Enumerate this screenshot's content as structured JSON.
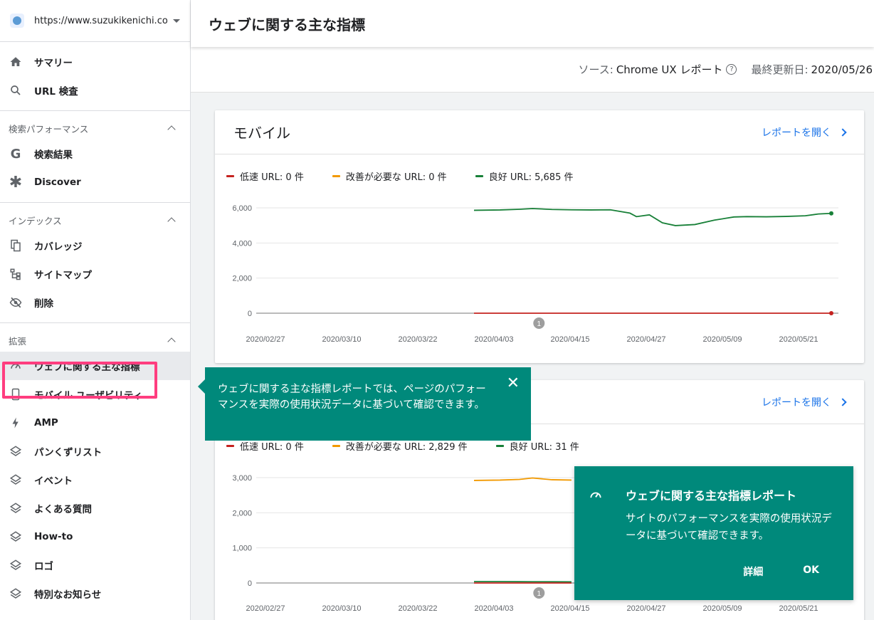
{
  "property": {
    "url": "https://www.suzukikenichi.co..."
  },
  "sidebar": {
    "top": [
      {
        "label": "サマリー",
        "icon": "home-icon"
      },
      {
        "label": "URL 検査",
        "icon": "search-icon"
      }
    ],
    "groups": [
      {
        "title": "検索パフォーマンス",
        "items": [
          {
            "label": "検索結果",
            "icon": "google-icon"
          },
          {
            "label": "Discover",
            "icon": "asterisk-icon"
          }
        ]
      },
      {
        "title": "インデックス",
        "items": [
          {
            "label": "カバレッジ",
            "icon": "copy-icon"
          },
          {
            "label": "サイトマップ",
            "icon": "sitemap-icon"
          },
          {
            "label": "削除",
            "icon": "eye-off-icon"
          }
        ]
      },
      {
        "title": "拡張",
        "items": [
          {
            "label": "ウェブに関する主な指標",
            "icon": "speedometer-icon"
          },
          {
            "label": "モバイル ユーザビリティ",
            "icon": "phone-icon"
          },
          {
            "label": "AMP",
            "icon": "bolt-icon"
          },
          {
            "label": "パンくずリスト",
            "icon": "layers-icon"
          },
          {
            "label": "イベント",
            "icon": "layers-icon"
          },
          {
            "label": "よくある質問",
            "icon": "layers-icon"
          },
          {
            "label": "How-to",
            "icon": "layers-icon"
          },
          {
            "label": "ロゴ",
            "icon": "layers-icon"
          },
          {
            "label": "特別なお知らせ",
            "icon": "layers-icon"
          }
        ]
      }
    ]
  },
  "header": {
    "title": "ウェブに関する主な指標"
  },
  "source": {
    "label": "ソース:",
    "value": "Chrome UX レポート",
    "updated_label": "最終更新日:",
    "updated_value": "2020/05/26"
  },
  "colors": {
    "poor": "#c5221f",
    "needs": "#f29900",
    "good": "#188038",
    "accent": "#00897b"
  },
  "mobile": {
    "title": "モバイル",
    "open_link": "レポートを開く",
    "legend": [
      "低速 URL: 0 件",
      "改善が必要な URL: 0 件",
      "良好 URL: 5,685 件"
    ],
    "annotation": "1"
  },
  "desktop": {
    "open_link": "レポートを開く",
    "legend": [
      "低速 URL: 0 件",
      "改善が必要な URL: 2,829 件",
      "良好 URL: 31 件"
    ],
    "annotation": "1"
  },
  "chart_data": [
    {
      "type": "line",
      "x_ticks": [
        "2020/02/27",
        "2020/03/10",
        "2020/03/22",
        "2020/04/03",
        "2020/04/15",
        "2020/04/27",
        "2020/05/09",
        "2020/05/21"
      ],
      "y_ticks": [
        "6,000",
        "4,000",
        "2,000",
        "0"
      ],
      "ylim": [
        0,
        6000
      ],
      "x": [
        "2020/04/01",
        "2020/04/05",
        "2020/04/08",
        "2020/04/10",
        "2020/04/13",
        "2020/04/16",
        "2020/04/19",
        "2020/04/22",
        "2020/04/25",
        "2020/04/26",
        "2020/04/28",
        "2020/04/30",
        "2020/05/02",
        "2020/05/05",
        "2020/05/08",
        "2020/05/11",
        "2020/05/13",
        "2020/05/16",
        "2020/05/19",
        "2020/05/22",
        "2020/05/24",
        "2020/05/26"
      ],
      "series": [
        {
          "name": "良好 URL: 5,685 件",
          "values": [
            5860,
            5880,
            5920,
            5960,
            5910,
            5890,
            5880,
            5890,
            5700,
            5500,
            5600,
            5150,
            4990,
            5050,
            5300,
            5480,
            5500,
            5490,
            5510,
            5550,
            5650,
            5685
          ]
        },
        {
          "name": "低速 URL: 0 件",
          "values": [
            0,
            0,
            0,
            0,
            0,
            0,
            0,
            0,
            0,
            0,
            0,
            0,
            0,
            0,
            0,
            0,
            0,
            0,
            0,
            0,
            0,
            0
          ]
        }
      ]
    },
    {
      "type": "line",
      "x_ticks": [
        "2020/02/27",
        "2020/03/10",
        "2020/03/22",
        "2020/04/03",
        "2020/04/15",
        "2020/04/27",
        "2020/05/09",
        "2020/05/21"
      ],
      "y_ticks": [
        "3,000",
        "2,000",
        "1,000",
        "0"
      ],
      "ylim": [
        0,
        3000
      ],
      "x": [
        "2020/04/01",
        "2020/04/05",
        "2020/04/08",
        "2020/04/10",
        "2020/04/13",
        "2020/04/16"
      ],
      "series": [
        {
          "name": "改善が必要な URL: 2,829 件",
          "values": [
            2920,
            2930,
            2950,
            2990,
            2940,
            2930
          ]
        },
        {
          "name": "良好 URL: 31 件",
          "values": [
            40,
            40,
            38,
            36,
            34,
            32
          ]
        },
        {
          "name": "低速 URL: 0 件",
          "values": [
            0,
            0,
            0,
            0,
            0,
            0
          ]
        }
      ]
    }
  ],
  "tooltip": {
    "text": "ウェブに関する主な指標レポートでは、ページのパフォーマンスを実際の使用状況データに基づいて確認できます。",
    "close": "✕"
  },
  "popup": {
    "title": "ウェブに関する主な指標レポート",
    "body": "サイトのパフォーマンスを実際の使用状況データに基づいて確認できます。",
    "details_label": "詳細",
    "ok_label": "OK"
  }
}
